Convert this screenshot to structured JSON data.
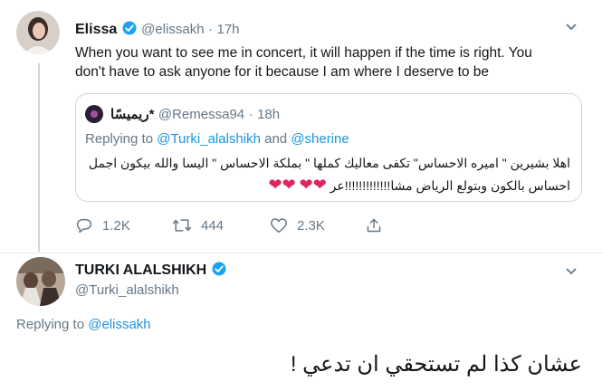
{
  "tweet1": {
    "author_name": "Elissa",
    "handle": "@elissakh",
    "time": "17h",
    "text_line1": "When you want to see me in concert, it will happen if the time is right. You",
    "text_line2": "don't have to ask anyone for it because I am where I deserve to be"
  },
  "quote": {
    "author_name": "ريميسًا*",
    "handle": "@Remessa94",
    "time": "18h",
    "replying_prefix": "Replying to",
    "replying_user1": "@Turki_alalshikh",
    "replying_and": "and",
    "replying_user2": "@sherine",
    "line1": "اهلا بشيرين \" اميره الاحساس\" تكفى معاليك كملها \" بملكة الاحساس \" اليسا والله بيكون اجمل",
    "line2": "احساس بالكون وبتولع الرياض مشا!!!!!!!!!!!!!عر",
    "hearts": [
      "❤",
      "❤",
      "❤",
      "❤"
    ]
  },
  "actions": {
    "replies": "1.2K",
    "retweets": "444",
    "likes": "2.3K"
  },
  "tweet2": {
    "author_name": "TURKI ALALSHIKH",
    "handle": "@Turki_alalshikh",
    "replying_prefix": "Replying to",
    "replying_user": "@elissakh",
    "text": "عشان كذا لم تستحقي ان تدعي !"
  },
  "colors": {
    "accent": "#1b95e0",
    "muted": "#657786",
    "heart": "#e0245e",
    "border": "#ccd6dd"
  }
}
